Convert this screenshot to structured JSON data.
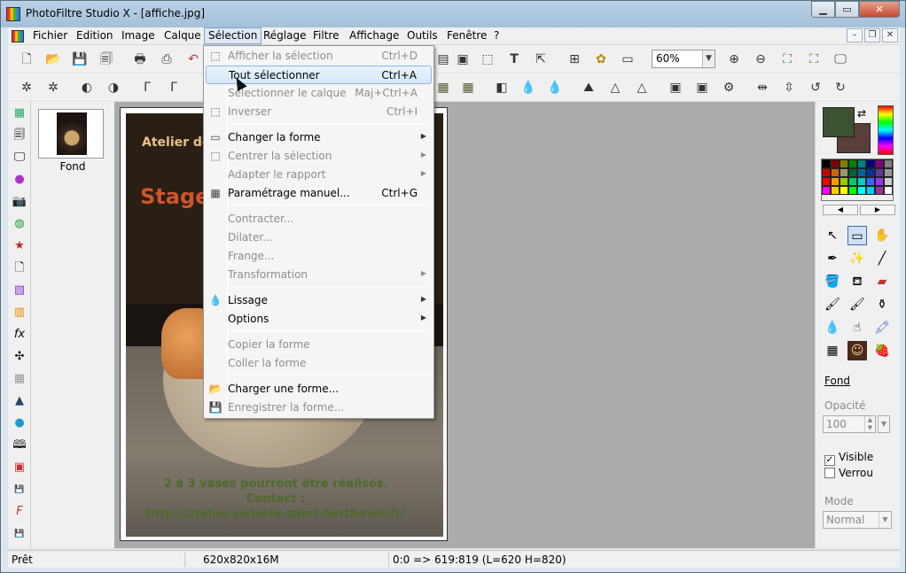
{
  "window": {
    "title": "PhotoFiltre Studio X - [affiche.jpg]"
  },
  "menubar": {
    "items": [
      "Fichier",
      "Edition",
      "Image",
      "Calque",
      "Sélection",
      "Réglage",
      "Filtre",
      "Affichage",
      "Outils",
      "Fenêtre",
      "?"
    ]
  },
  "toolbar": {
    "zoom": "60%"
  },
  "layers": {
    "fond_label": "Fond"
  },
  "poster": {
    "line1": "Atelier de",
    "line2": "Stage",
    "line3": "2 à 3 vases pourront être réalisés.",
    "line4": "Contact :",
    "line5": "http://atelier-poterie-saint-berthevin.fr/"
  },
  "selection_menu": {
    "items": [
      {
        "label": "Afficher la sélection",
        "shortcut": "Ctrl+D",
        "enabled": false
      },
      {
        "label": "Tout sélectionner",
        "shortcut": "Ctrl+A",
        "enabled": true,
        "highlighted": true
      },
      {
        "label": "Sélectionner le calque",
        "shortcut": "Maj+Ctrl+A",
        "enabled": false
      },
      {
        "label": "Inverser",
        "shortcut": "Ctrl+I",
        "enabled": false
      },
      {
        "label": "Changer la forme",
        "shortcut": "",
        "enabled": true,
        "submenu": true
      },
      {
        "label": "Centrer la sélection",
        "shortcut": "",
        "enabled": false,
        "submenu": true
      },
      {
        "label": "Adapter le rapport",
        "shortcut": "",
        "enabled": false,
        "submenu": true
      },
      {
        "label": "Paramétrage manuel...",
        "shortcut": "Ctrl+G",
        "enabled": true
      },
      {
        "label": "Contracter...",
        "shortcut": "",
        "enabled": false
      },
      {
        "label": "Dilater...",
        "shortcut": "",
        "enabled": false
      },
      {
        "label": "Frange...",
        "shortcut": "",
        "enabled": false
      },
      {
        "label": "Transformation",
        "shortcut": "",
        "enabled": false,
        "submenu": true
      },
      {
        "label": "Lissage",
        "shortcut": "",
        "enabled": true,
        "submenu": true
      },
      {
        "label": "Options",
        "shortcut": "",
        "enabled": true,
        "submenu": true
      },
      {
        "label": "Copier la forme",
        "shortcut": "",
        "enabled": false
      },
      {
        "label": "Coller la forme",
        "shortcut": "",
        "enabled": false
      },
      {
        "label": "Charger une forme...",
        "shortcut": "",
        "enabled": true
      },
      {
        "label": "Enregistrer la forme...",
        "shortcut": "",
        "enabled": false
      }
    ]
  },
  "right_panel": {
    "layer_name": "Fond",
    "opacity_label": "Opacité",
    "opacity_value": "100",
    "visible_label": "Visible",
    "visible_checked": true,
    "lock_label": "Verrou",
    "lock_checked": false,
    "mode_label": "Mode",
    "mode_value": "Normal",
    "fg_color": "#3d5230",
    "bg_color": "#5a3e3a"
  },
  "status": {
    "state": "Prêt",
    "image_info": "620x820x16M",
    "selection_info": "0:0 => 619:819 (L=620  H=820)"
  }
}
